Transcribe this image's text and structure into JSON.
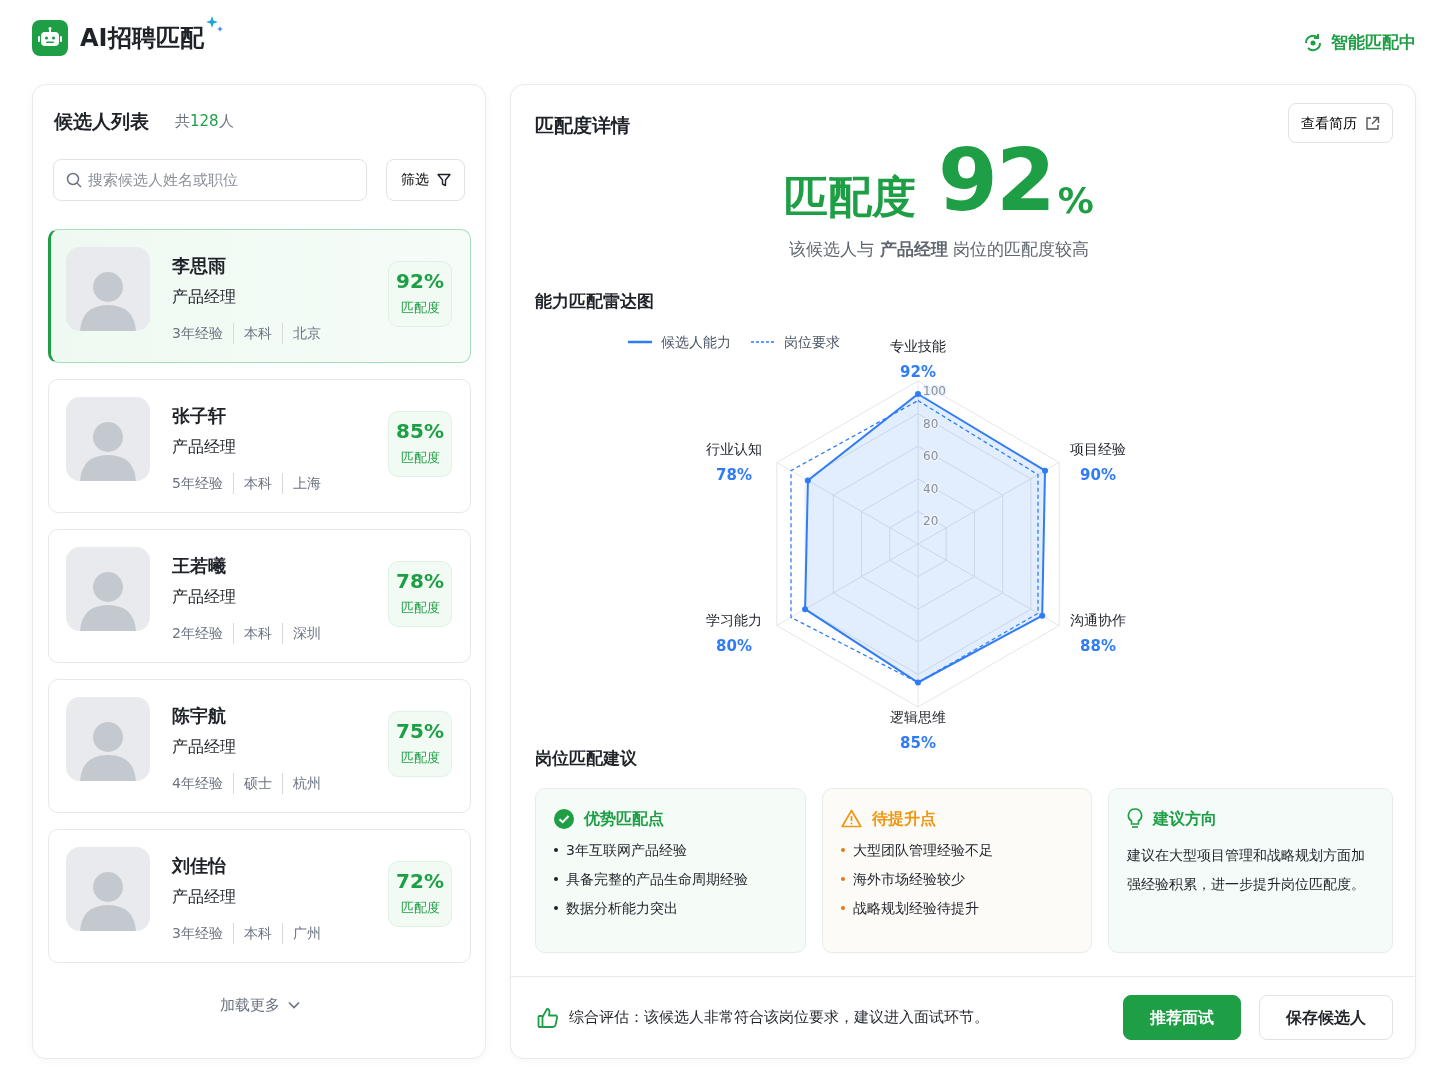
{
  "header": {
    "title": "AI招聘匹配",
    "status": "智能匹配中"
  },
  "candidate_list": {
    "title": "候选人列表",
    "count": {
      "prefix": "共",
      "number": "128",
      "suffix": "人"
    },
    "search": {
      "placeholder": "搜索候选人姓名或职位"
    },
    "filter_button": "筛选",
    "candidates": [
      {
        "name": "李思雨",
        "position": "产品经理",
        "meta": [
          "3年经验",
          "本科",
          "北京"
        ],
        "score": "92%",
        "score_label": "匹配度",
        "selected": true
      },
      {
        "name": "张子轩",
        "position": "产品经理",
        "meta": [
          "5年经验",
          "本科",
          "上海"
        ],
        "score": "85%",
        "score_label": "匹配度",
        "selected": false
      },
      {
        "name": "王若曦",
        "position": "产品经理",
        "meta": [
          "2年经验",
          "本科",
          "深圳"
        ],
        "score": "78%",
        "score_label": "匹配度",
        "selected": false
      },
      {
        "name": "陈宇航",
        "position": "产品经理",
        "meta": [
          "4年经验",
          "硕士",
          "杭州"
        ],
        "score": "75%",
        "score_label": "匹配度",
        "selected": false
      },
      {
        "name": "刘佳怡",
        "position": "产品经理",
        "meta": [
          "3年经验",
          "本科",
          "广州"
        ],
        "score": "72%",
        "score_label": "匹配度",
        "selected": false
      }
    ],
    "load_more": "加载更多"
  },
  "detail": {
    "title": "匹配度详情",
    "resume_button": "查看简历",
    "score_label": "匹配度",
    "score": "92",
    "score_unit": "%",
    "summary": "该候选人与 **产品经理** 岗位的匹配度较高",
    "radar": {
      "title": "能力匹配雷达图",
      "chart_data": {
        "type": "radar",
        "categories": [
          "专业技能",
          "项目经验",
          "沟通协作",
          "逻辑思维",
          "学习能力",
          "行业认知"
        ],
        "yticks": [
          20,
          40,
          60,
          80,
          100
        ],
        "ylim": [
          0,
          100
        ],
        "series": [
          {
            "name": "候选人能力",
            "color": "#2f7cf6",
            "values": [
              92,
              90,
              88,
              85,
              80,
              78
            ]
          },
          {
            "name": "岗位要求",
            "color": "#2f7cf6",
            "values": [
              88,
              85,
              85,
              85,
              90,
              90
            ]
          }
        ],
        "value_labels": [
          "92%",
          "90%",
          "88%",
          "85%",
          "80%",
          "78%"
        ],
        "legend": true
      }
    },
    "suggestions": {
      "title": "岗位匹配建议",
      "cards": [
        {
          "kind": "strength",
          "title": "优势匹配点",
          "items": [
            "3年互联网产品经验",
            "具备完整的产品生命周期经验",
            "数据分析能力突出"
          ]
        },
        {
          "kind": "improve",
          "title": "待提升点",
          "items": [
            "大型团队管理经验不足",
            "海外市场经验较少",
            "战略规划经验待提升"
          ]
        },
        {
          "kind": "advice",
          "title": "建议方向",
          "text": "建议在大型项目管理和战略规划方面加强经验积累，进一步提升岗位匹配度。"
        }
      ]
    },
    "footer": {
      "assessment": "综合评估：该候选人非常符合该岗位要求，建议进入面试环节。",
      "buttons": [
        {
          "label": "推荐面试",
          "primary": true
        },
        {
          "label": "保存候选人",
          "primary": false
        }
      ]
    }
  }
}
